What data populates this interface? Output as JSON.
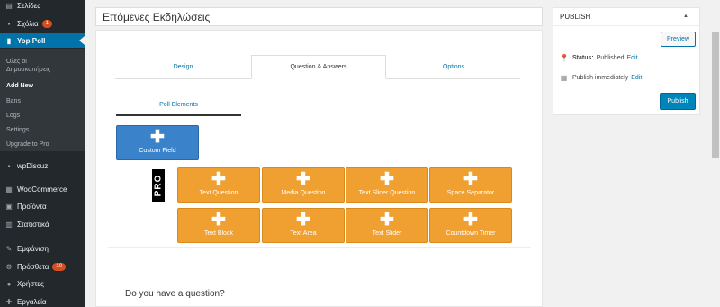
{
  "sidebar": {
    "items": [
      {
        "label": "Σελίδες",
        "icon": "pages-icon",
        "glyph": "▤"
      },
      {
        "label": "Σχόλια",
        "icon": "comments-icon",
        "glyph": "▪",
        "badge": "1"
      },
      {
        "label": "Yop Poll",
        "icon": "poll-icon",
        "glyph": "▮"
      },
      {
        "label": "wpDiscuz",
        "icon": "discuz-icon",
        "glyph": "▪"
      },
      {
        "label": "WooCommerce",
        "icon": "woocommerce-icon",
        "glyph": "▦"
      },
      {
        "label": "Προϊόντα",
        "icon": "products-icon",
        "glyph": "▣"
      },
      {
        "label": "Στατιστικά",
        "icon": "stats-icon",
        "glyph": "▥"
      },
      {
        "label": "Εμφάνιση",
        "icon": "appearance-icon",
        "glyph": "✎"
      },
      {
        "label": "Πρόσθετα",
        "icon": "plugins-icon",
        "glyph": "⚙",
        "badge": "10"
      },
      {
        "label": "Χρήστες",
        "icon": "users-icon",
        "glyph": "●"
      },
      {
        "label": "Εργαλεία",
        "icon": "tools-icon",
        "glyph": "✚"
      }
    ],
    "submenu": {
      "all_polls_line1": "Όλες οι",
      "all_polls_line2": "Δημοσκοπήσεις",
      "add_new": "Add New",
      "bans": "Bans",
      "logs": "Logs",
      "settings": "Settings",
      "upgrade": "Upgrade to Pro"
    }
  },
  "title": "Επόμενες Εκδηλώσεις",
  "tabs": [
    "Design",
    "Question & Answers",
    "Options"
  ],
  "poll_elements_label": "Poll Elements",
  "custom_field": {
    "label": "Custom Field",
    "plus": "✚"
  },
  "pro_label": "PRO",
  "pro_buttons": [
    {
      "label": "Text Question",
      "plus": "✚"
    },
    {
      "label": "Media Question",
      "plus": "✚"
    },
    {
      "label": "Text Slider Question",
      "plus": "✚"
    },
    {
      "label": "Space Separator",
      "plus": "✚"
    },
    {
      "label": "Text Block",
      "plus": "✚"
    },
    {
      "label": "Text Area",
      "plus": "✚"
    },
    {
      "label": "Text Slider",
      "plus": "✚"
    },
    {
      "label": "Countdown Timer",
      "plus": "✚"
    }
  ],
  "question_text": "Do you have a question?",
  "publish": {
    "header": "PUBLISH",
    "preview": "Preview",
    "status_label": "Status:",
    "status_value": "Published",
    "edit": "Edit",
    "publish_time": "Publish immediately",
    "edit2": "Edit",
    "publish_button": "Publish"
  },
  "colors": {
    "sidebar_bg": "#23282d",
    "active_bg": "#0073aa",
    "custom_field_bg": "#3a83cb",
    "pro_button_bg": "#f0a030",
    "publish_btn_bg": "#0085ba"
  }
}
